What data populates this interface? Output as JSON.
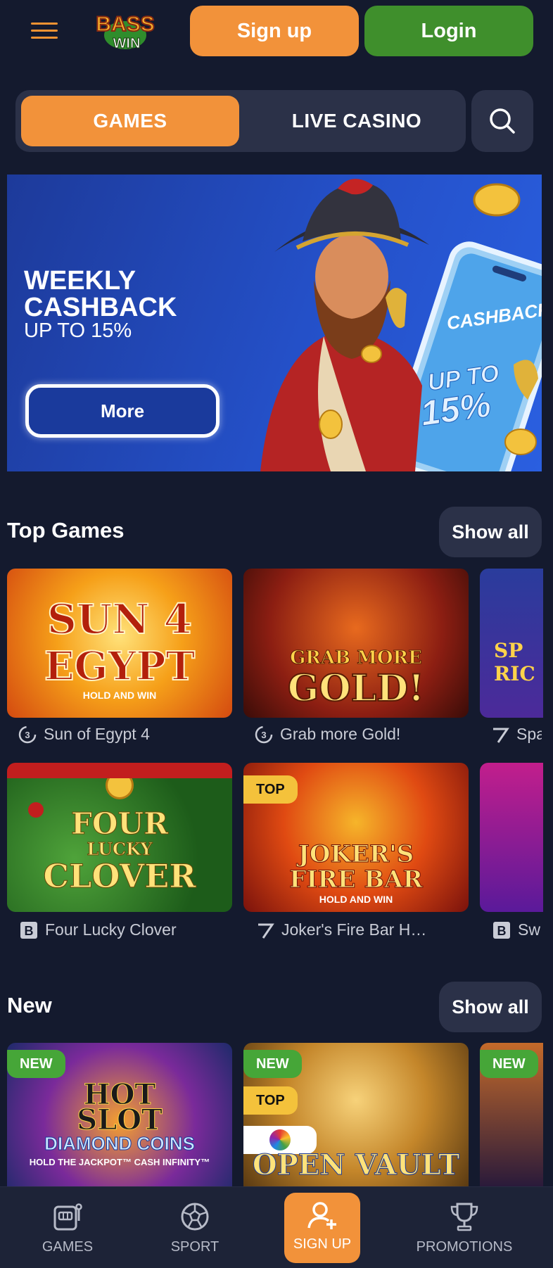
{
  "header": {
    "logo_text_top": "BASS",
    "logo_text_bottom": "WIN",
    "signup_label": "Sign up",
    "login_label": "Login"
  },
  "tabs": {
    "games": "GAMES",
    "live_casino": "LIVE CASINO"
  },
  "banner": {
    "title_line1": "WEEKLY",
    "title_line2": "CASHBACK",
    "subtitle": "UP TO 15%",
    "more_label": "More",
    "phone_caption": "CASHBACK",
    "phone_upto": "UP TO",
    "phone_percent": "15%"
  },
  "top_games": {
    "title": "Top Games",
    "show_all": "Show all",
    "cards": [
      {
        "name": "Sun of Egypt 4",
        "art_l1": "SUN 4",
        "art_l2": "EGYPT",
        "art_l3": "HOLD AND WIN",
        "provider_icon": "provider-3-icon"
      },
      {
        "name": "Grab more Gold!",
        "art_l1": "GRAB MORE",
        "art_l2": "GOLD!",
        "provider_icon": "provider-3-icon"
      },
      {
        "name": "Spa",
        "art_l1": "SP",
        "art_l2": "RIC",
        "provider_icon": "provider-7-icon"
      },
      {
        "name": "Four Lucky Clover",
        "art_l1": "FOUR",
        "art_l2": "LUCKY",
        "art_l3": "CLOVER",
        "provider_icon": "provider-b-icon"
      },
      {
        "name": "Joker's Fire Bar H…",
        "art_l1": "JOKER'S",
        "art_l2": "FIRE BAR",
        "art_l3": "HOLD AND WIN",
        "badge": "TOP",
        "provider_icon": "provider-7-icon"
      },
      {
        "name": "Sw",
        "provider_icon": "provider-b-icon"
      }
    ]
  },
  "new_games": {
    "title": "New",
    "show_all": "Show all",
    "cards": [
      {
        "badge": "NEW",
        "art_l1": "HOT",
        "art_l2": "SLOT",
        "art_l3": "DIAMOND COINS",
        "art_l4": "HOLD THE JACKPOT™ CASH INFINITY™"
      },
      {
        "badge": "NEW",
        "badge2": "TOP",
        "art_l1": "OPEN VAULT"
      },
      {
        "badge": "NEW"
      }
    ]
  },
  "bottom_nav": {
    "games": "GAMES",
    "sport": "SPORT",
    "signup": "SIGN UP",
    "promotions": "PROMOTIONS"
  },
  "colors": {
    "background": "#141a2e",
    "accent_orange": "#f2923a",
    "login_green": "#3f8f2c",
    "panel": "#2b3148",
    "badge_top": "#f4c23b",
    "badge_new": "#46a638"
  }
}
